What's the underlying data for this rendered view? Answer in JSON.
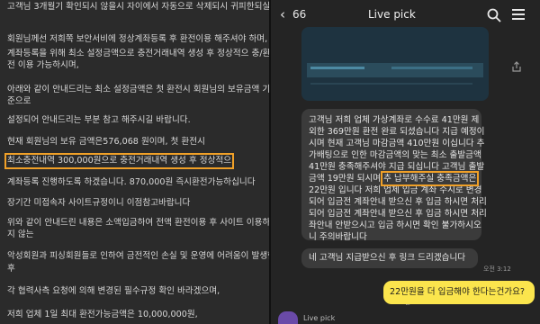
{
  "left_text": [
    "고객님 3개월기 확인되시 않을시 자이에서 자동으로 삭제되시 귀피한되실",
    "회원님께선 저희쪽 보안서비에 정상계좌등록 후 환전이용 해주셔야 하며,",
    "계좌등록을 위해 최소 설정금액으로 충전거래내역 생성 후 정상적으 충/환",
    "전 이용 가능하시며,",
    "아래와 같이 안내드리는 최소 설정금액은 첫 환전시 회원님의 보유금액 기",
    "준으로",
    "설정되어 안내드리는 부분 참고 해주시길 바랍니다.",
    "현재 회원님의 보유 금액은576,068 원이며, 첫 환전시",
    "최소충전내역 300,000원으로 충전거래내역 생성 후 정상적으",
    "계좌등록 진행하도록 하겠습니다. 870,000원 즉시환전가능하십니다",
    "장기간 미접속자 사이트규정이니 이점참고바랍니다",
    "위와 같이 안내드린 내용은 소액입금하여 전액 환전이용 후 사이트 이용하",
    "지 않는",
    "악성회원과 피싱회원들로 인하여 금전적인 손실 및 운영에 어려움이 발생한",
    "후",
    "각 협력사측 요청에 의해 변경된 필수규정 확인 바라겠으며,",
    "저희 업체 1일 최대 환전가능금액은 10,000,000원,"
  ],
  "header": {
    "back_icon": "chevron-left-icon",
    "back_count": "66",
    "title": "Live pick"
  },
  "message1": [
    "고객님 저희 업체 가상계좌로 수수료 41만원 제",
    "외한 369만원 환전 완료 되셨습니다 지급 예정이",
    "시며 현재 고객님 마감금액 410만원 이십니다 추",
    "가배팅으로 인한 마감금액의 맞는 최소 출발금액",
    "41만원 충족해주셔야 지급 되십니다 고객님 출발",
    "금액 19만원 되시며 추 납부해주실 충족금액은",
    "22만원 입니다 저희 업체 입금 계좌 수시로 변경",
    "되어 입금전 계좌안내 받으신 후 입금 하시면 처리",
    "되어 입금전 계좌안내 받으신 후 입금 하시면 처리",
    "좌안내 안받으시고 입금 하시면 확인 불가하시오",
    "니 주의바랍니다"
  ],
  "message1_highlight": "추 납부해주실 충족금액은",
  "message2": "네 고객님 지급받으신 후 링크 드리겠습니다",
  "message2_time": "오전 3:12",
  "my_message": "22만원을 더 입금해야 한다는건가요?",
  "my_message_time": "오전 3:12",
  "next_sender": "Live pick",
  "colors": {
    "highlight_outline": "#f0a028",
    "my_bubble": "#fbe54d",
    "other_bubble": "#3b3b3b",
    "chat_bg": "#242424"
  }
}
